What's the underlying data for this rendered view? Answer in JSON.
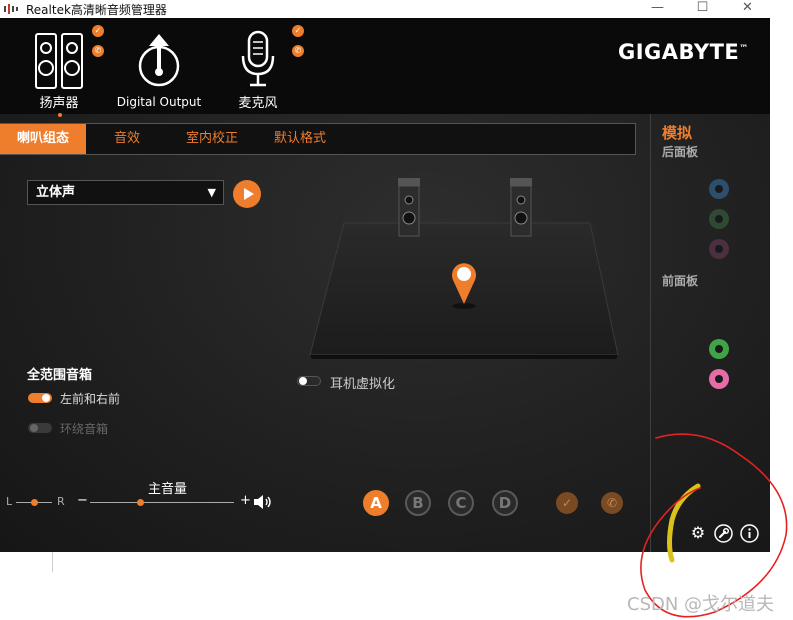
{
  "window": {
    "title": "Realtek高清晰音频管理器",
    "minimize_glyph": "—",
    "maximize_glyph": "☐",
    "close_glyph": "✕"
  },
  "brand": {
    "logo": "GIGABYTE",
    "trademark": "™"
  },
  "devices": [
    {
      "label": "扬声器",
      "icon": "speaker-icon",
      "active": true
    },
    {
      "label": "Digital Output",
      "icon": "digital-output-icon",
      "active": false
    },
    {
      "label": "麦克风",
      "icon": "microphone-icon",
      "active": false
    }
  ],
  "tabs": [
    {
      "label": "喇叭组态",
      "active": true
    },
    {
      "label": "音效",
      "active": false
    },
    {
      "label": "室内校正",
      "active": false
    },
    {
      "label": "默认格式",
      "active": false
    }
  ],
  "config": {
    "selected": "立体声",
    "caret": "▼"
  },
  "full_range": {
    "heading": "全范围音箱",
    "front_lr": {
      "label": "左前和右前",
      "on": true
    },
    "surround": {
      "label": "环绕音箱",
      "on": false
    }
  },
  "headphone_virtualization": {
    "label": "耳机虚拟化",
    "on": false
  },
  "volume": {
    "label": "主音量",
    "balance_left": "L",
    "balance_right": "R",
    "minus": "−",
    "plus": "+",
    "balance": 0.5,
    "level": 0.35
  },
  "profiles": [
    {
      "label": "A",
      "selected": true
    },
    {
      "label": "B",
      "selected": false
    },
    {
      "label": "C",
      "selected": false
    },
    {
      "label": "D",
      "selected": false
    }
  ],
  "side_panel": {
    "heading": "模拟",
    "rear_panel": "后面板",
    "front_panel": "前面板",
    "rear_jacks": [
      "#2d4f6e",
      "#2e4a33",
      "#4a3040"
    ],
    "front_jacks": [
      "#3fa447",
      "#e56ca6"
    ]
  },
  "bottom_icons": [
    "gear-icon",
    "wrench-icon",
    "info-icon"
  ],
  "watermark": "CSDN @戈尔道夫",
  "colors": {
    "accent": "#ee7d2c",
    "background": "#1e1e1e",
    "topbar": "#0a0a0a",
    "annotation": "#e52222"
  }
}
